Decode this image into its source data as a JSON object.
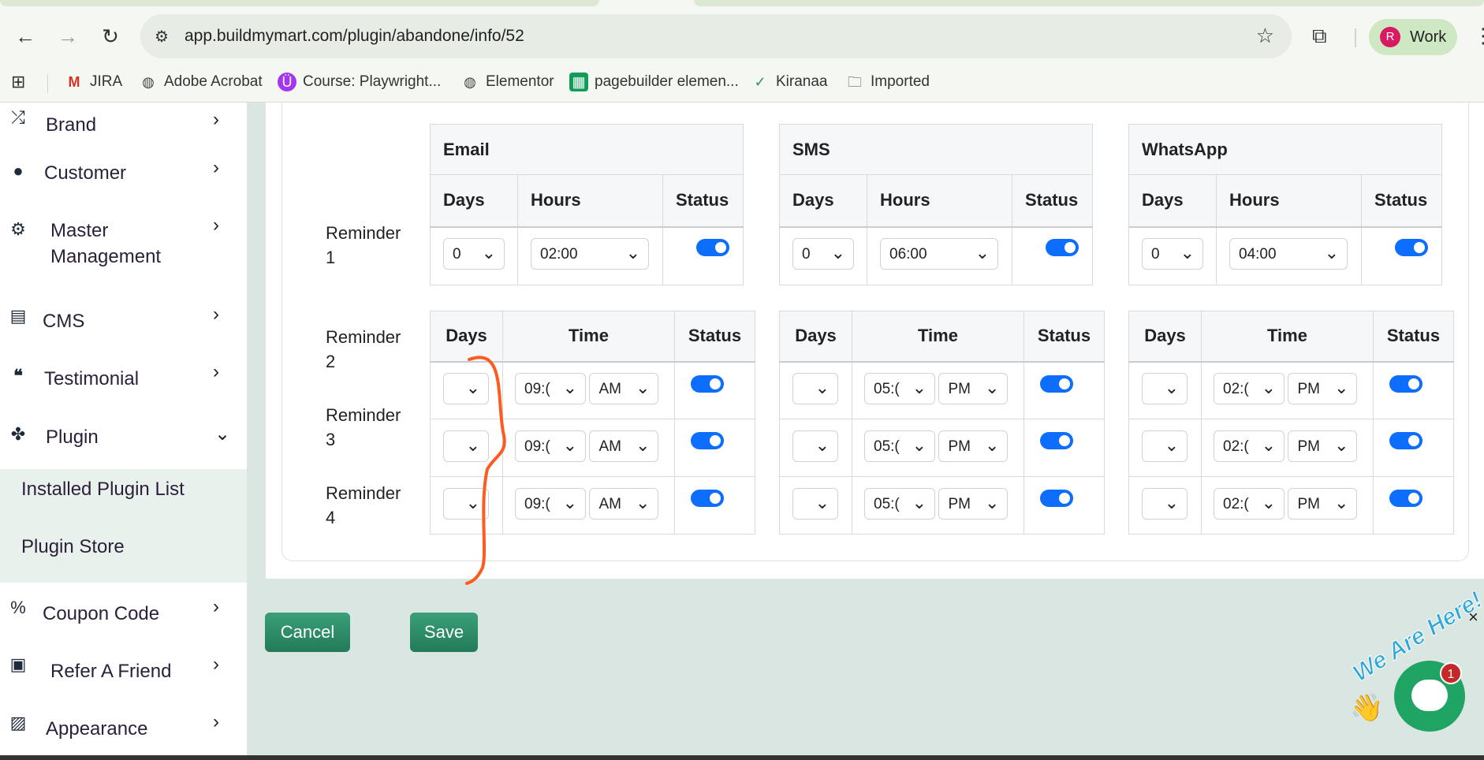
{
  "browser": {
    "url": "app.buildmymart.com/plugin/abandone/info/52",
    "profile_initial": "R",
    "profile_name": "Work",
    "bookmarks": [
      {
        "icon": "gmail-icon",
        "label": "JIRA"
      },
      {
        "icon": "globe-icon",
        "label": "Adobe Acrobat"
      },
      {
        "icon": "udemy-icon",
        "label": "Course: Playwright..."
      },
      {
        "icon": "globe-icon",
        "label": "Elementor"
      },
      {
        "icon": "sheets-icon",
        "label": "pagebuilder elemen..."
      },
      {
        "icon": "check-circle-icon",
        "label": "Kiranaa"
      },
      {
        "icon": "folder-icon",
        "label": "Imported"
      }
    ]
  },
  "sidebar": {
    "items": [
      {
        "label": "Brand",
        "icon": "shuffle-icon"
      },
      {
        "label": "Customer",
        "icon": "user-icon"
      },
      {
        "label": "Master Management",
        "icon": "user-gear-icon"
      },
      {
        "label": "CMS",
        "icon": "file-icon"
      },
      {
        "label": "Testimonial",
        "icon": "quote-icon"
      },
      {
        "label": "Plugin",
        "icon": "puzzle-icon"
      }
    ],
    "plugin_subitems": [
      "Installed Plugin List",
      "Plugin Store"
    ],
    "items_after": [
      {
        "label": "Coupon Code",
        "icon": "percent-icon"
      },
      {
        "label": "Refer A Friend",
        "icon": "id-card-icon"
      },
      {
        "label": "Appearance",
        "icon": "image-icon"
      }
    ]
  },
  "reminders": {
    "r1_label": "Reminder 1",
    "r2_label": "Reminder 2",
    "r3_label": "Reminder 3",
    "r4_label": "Reminder 4",
    "channels": [
      "Email",
      "SMS",
      "WhatsApp"
    ],
    "headers_r1": {
      "days": "Days",
      "hours": "Hours",
      "status": "Status"
    },
    "headers_r2": {
      "days": "Days",
      "time": "Time",
      "status": "Status"
    },
    "r1": {
      "email": {
        "days": "0",
        "hours": "02:00",
        "status": true
      },
      "sms": {
        "days": "0",
        "hours": "06:00",
        "status": true
      },
      "whatsapp": {
        "days": "0",
        "hours": "04:00",
        "status": true
      }
    },
    "rows": {
      "email": {
        "time": "09:(",
        "ampm": "AM"
      },
      "sms": {
        "time": "05:(",
        "ampm": "PM"
      },
      "whatsapp": {
        "time": "02:(",
        "ampm": "PM"
      }
    }
  },
  "actions": {
    "cancel": "Cancel",
    "save": "Save"
  },
  "chat": {
    "badge": "1",
    "tagline": "We Are Here!",
    "close": "×"
  },
  "colors": {
    "accent": "#0d6efd",
    "button": "#2e8b65",
    "annotation": "#ff5a1f"
  }
}
